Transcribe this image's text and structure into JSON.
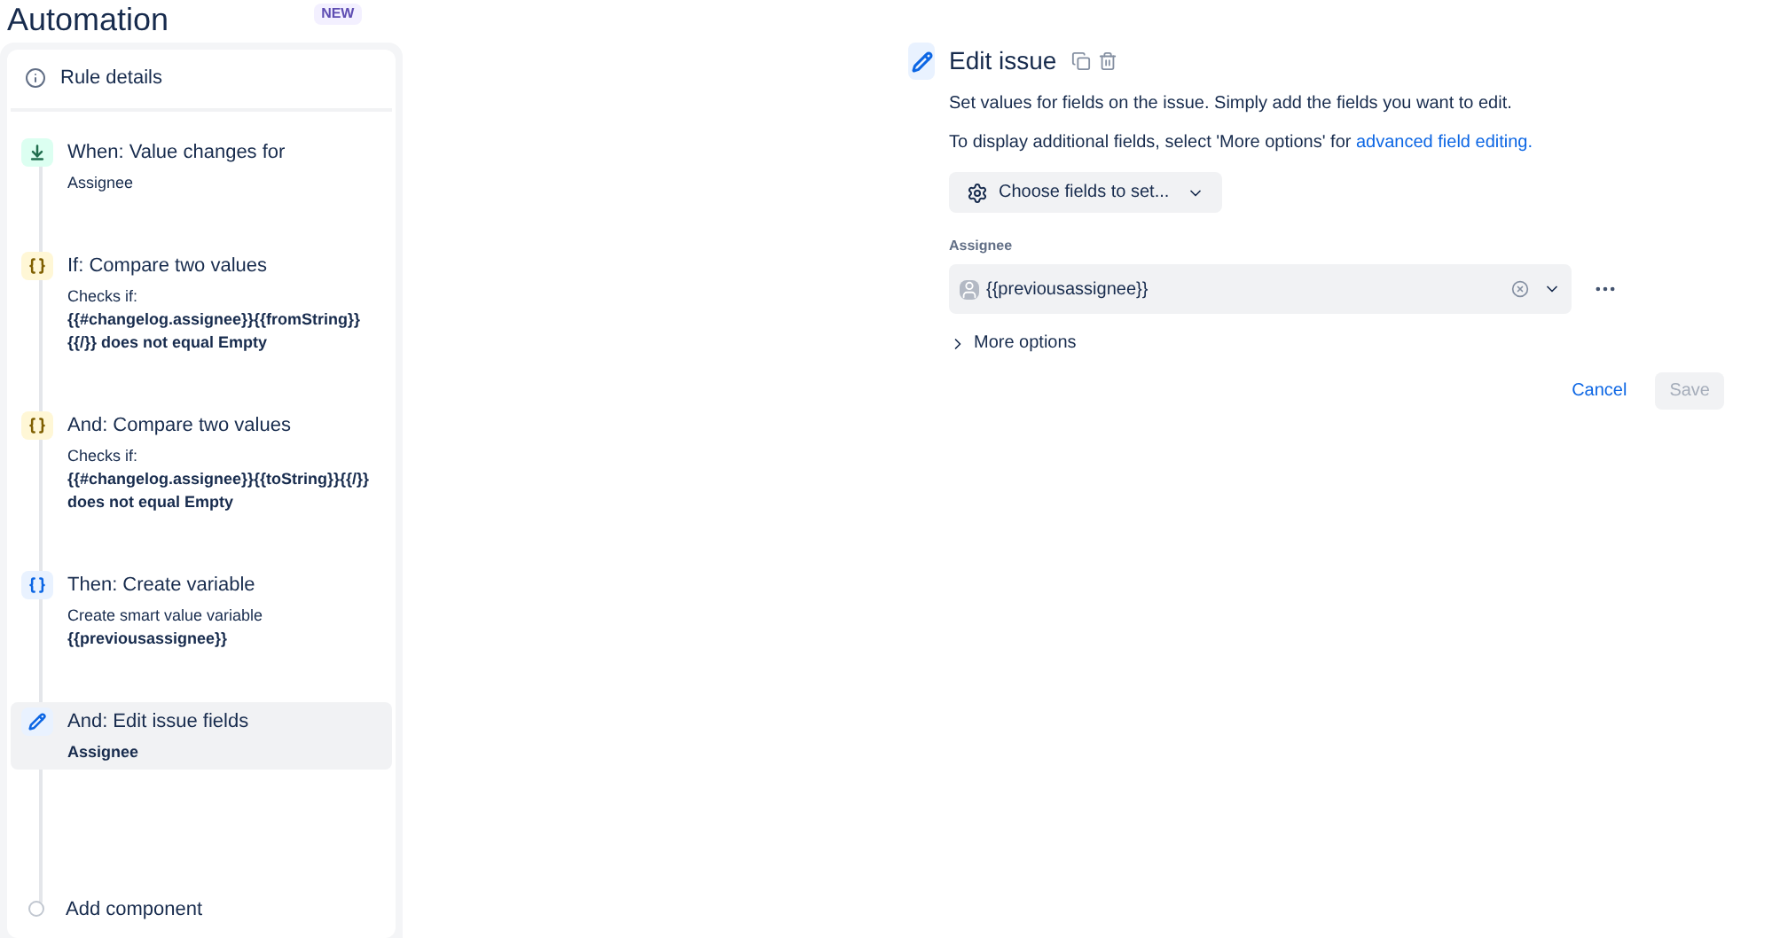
{
  "header": {
    "title": "Automation",
    "badge": "NEW"
  },
  "sidebar": {
    "rule_details": "Rule details",
    "steps": [
      {
        "kind": "trigger",
        "title": "When: Value changes for",
        "selected": false,
        "details": [
          {
            "text": "Assignee",
            "bold": false
          }
        ]
      },
      {
        "kind": "condition",
        "title": "If: Compare two values",
        "selected": false,
        "details": [
          {
            "text": "Checks if:",
            "bold": false
          },
          {
            "text": "{{#changelog.assignee}}{{fromString}}{{/}} does not equal Empty",
            "bold": true
          }
        ]
      },
      {
        "kind": "condition",
        "title": "And: Compare two values",
        "selected": false,
        "details": [
          {
            "text": "Checks if:",
            "bold": false
          },
          {
            "text": "{{#changelog.assignee}}{{toString}}{{/}} does not equal Empty",
            "bold": true
          }
        ]
      },
      {
        "kind": "variable",
        "title": "Then: Create variable",
        "selected": false,
        "details": [
          {
            "text": "Create smart value variable",
            "bold": false
          },
          {
            "text": "{{previousassignee}}",
            "bold": true
          }
        ]
      },
      {
        "kind": "action",
        "title": "And: Edit issue fields",
        "selected": true,
        "details": [
          {
            "text": "Assignee",
            "bold": true
          }
        ]
      }
    ],
    "add_component": "Add component"
  },
  "editor": {
    "title": "Edit issue",
    "description": "Set values for fields on the issue. Simply add the fields you want to edit.",
    "hint": "To display additional fields, select 'More options' for",
    "hint_link": "advanced field editing.",
    "choose_button": "Choose fields to set...",
    "field_label": "Assignee",
    "field_value": "{{previousassignee}}",
    "more_options": "More options",
    "more_expanded": false,
    "cancel": "Cancel",
    "save": "Save",
    "save_disabled": true
  }
}
